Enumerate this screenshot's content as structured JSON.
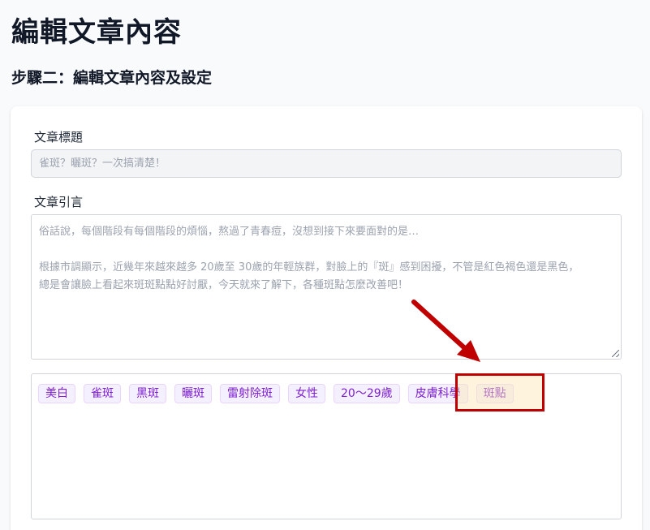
{
  "page": {
    "title": "編輯文章內容",
    "step_title": "步驟二：編輯文章內容及設定"
  },
  "form": {
    "title_label": "文章標題",
    "title_value": "雀斑？曬斑？一次搞清楚！",
    "intro_label": "文章引言",
    "intro_lines": [
      "俗話說，每個階段有每個階段的煩惱，熬過了青春痘，沒想到接下來要面對的是…",
      "",
      "根據市調顯示，近幾年來越來越多 20歲至 30歲的年輕族群，對臉上的『斑』感到困擾，不管是紅色褐色還是黑色，",
      "總是會讓臉上看起來斑斑點點好討厭，今天就來了解下，各種斑點怎麼改善吧！"
    ],
    "tags": [
      "美白",
      "雀斑",
      "黑斑",
      "曬斑",
      "雷射除斑",
      "女性",
      "20～29歲",
      "皮膚科學",
      "斑點"
    ]
  },
  "annotation": {
    "arrow_color": "#c00000",
    "highlighted_tag": "斑點"
  }
}
